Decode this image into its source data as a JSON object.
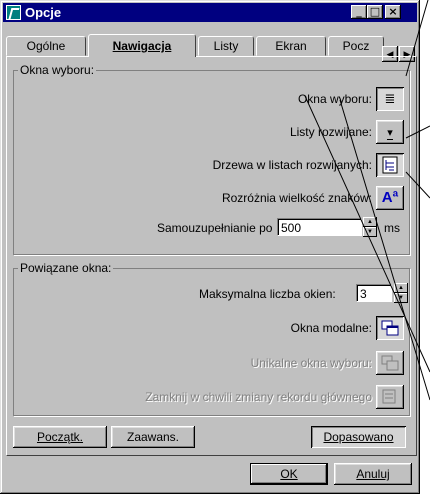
{
  "window": {
    "title": "Opcje",
    "controls": {
      "minimize": "_",
      "maximize": "□",
      "close": "×"
    }
  },
  "tabs": [
    {
      "label": "Ogólne",
      "u": "O"
    },
    {
      "label": "Nawigacja",
      "u": "N"
    },
    {
      "label": "Listy",
      "u": "L"
    },
    {
      "label": "Ekran",
      "u": "k"
    },
    {
      "label": "Pocz",
      "u": "P"
    }
  ],
  "tab_scroll": {
    "left": "◀",
    "right": "▶"
  },
  "okna_wyboru": {
    "group_label": "Okna wyboru:",
    "rows": [
      {
        "label": "Okna wyboru:",
        "icon": "list-window-icon"
      },
      {
        "label": "Listy rozwijane:",
        "icon": "dropdown-icon"
      },
      {
        "label": "Drzewa w listach rozwijanych:",
        "icon": "tree-list-icon"
      },
      {
        "label": "Rozróżnia wielkość znaków:",
        "icon": "case-sensitive-icon"
      }
    ],
    "autocomplete": {
      "label": "Samouzupełnianie po",
      "value": "500",
      "unit": "ms"
    }
  },
  "powiazane_okna": {
    "group_label": "Powiązane okna:",
    "max_windows": {
      "label": "Maksymalna liczba okien:",
      "value": "3"
    },
    "rows": [
      {
        "label": "Okna modalne:",
        "icon": "modal-window-icon",
        "enabled": true
      },
      {
        "label": "Unikalne okna wyboru:",
        "icon": "unique-window-icon",
        "enabled": false
      },
      {
        "label": "Zamknij w chwili zmiany rekordu głównego",
        "icon": "close-on-change-icon",
        "enabled": false
      }
    ]
  },
  "footer": {
    "start_button": "Początk.",
    "advanced_button": "Zaawans.",
    "fit_button": "Dopasowano",
    "ok_button": "OK",
    "cancel_button": "Anuluj"
  },
  "icon_glyphs": {
    "list": "≣",
    "dropdown": "▾",
    "case": "Aª"
  }
}
